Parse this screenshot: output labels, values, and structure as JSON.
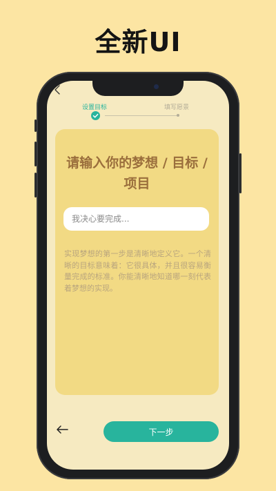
{
  "headline": "全新UI",
  "steps": [
    {
      "label": "设置目标",
      "state": "active"
    },
    {
      "label": "填写愿景",
      "state": "inactive"
    }
  ],
  "card": {
    "title": "请输入你的梦想 / 目标 / 项目",
    "input_placeholder": "我决心要完成...",
    "input_value": "",
    "description": "实现梦想的第一步是清晰地定义它。一个清晰的目标意味着：它很具体，并且很容易衡量完成的标准。你能清晰地知道哪一刻代表着梦想的实现。"
  },
  "footer": {
    "next_label": "下一步"
  },
  "icons": {
    "back": "chevron-left-icon",
    "bottom_back": "arrow-left-icon",
    "step_done": "check-icon"
  },
  "colors": {
    "page_background": "#fce5a3",
    "screen_background": "#f6eac1",
    "card_background": "#f2da84",
    "accent": "#28b49d",
    "title": "#9a6e3c",
    "description": "#b9a57e"
  }
}
